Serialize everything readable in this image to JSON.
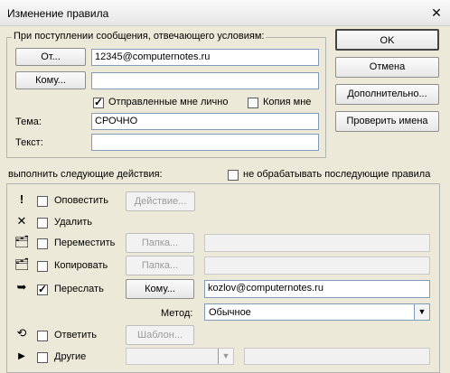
{
  "window": {
    "title": "Изменение правила",
    "close_glyph": "✕"
  },
  "conditions": {
    "group_title": "При поступлении сообщения, отвечающего условиям:",
    "from_button": "От...",
    "from_value": "12345@computernotes.ru",
    "to_button": "Кому...",
    "to_value": "",
    "sent_to_me_label": "Отправленные мне лично",
    "sent_to_me_checked": true,
    "cc_label": "Копия мне",
    "cc_checked": false,
    "subject_label": "Тема:",
    "subject_value": "СРОЧНО",
    "body_label": "Текст:",
    "body_value": ""
  },
  "side_buttons": {
    "ok": "OK",
    "cancel": "Отмена",
    "advanced": "Дополнительно...",
    "check_names": "Проверить имена"
  },
  "actions": {
    "header": "выполнить следующие действия:",
    "stop_processing_label": "не обрабатывать последующие правила",
    "stop_processing_checked": false,
    "notify": {
      "label": "Оповестить",
      "checked": false,
      "button": "Действие..."
    },
    "delete": {
      "label": "Удалить",
      "checked": false
    },
    "move": {
      "label": "Переместить",
      "checked": false,
      "button": "Папка...",
      "value": ""
    },
    "copy": {
      "label": "Копировать",
      "checked": false,
      "button": "Папка...",
      "value": ""
    },
    "forward": {
      "label": "Переслать",
      "checked": true,
      "button": "Кому...",
      "value": "kozlov@computernotes.ru"
    },
    "method": {
      "label": "Метод:",
      "value": "Обычное"
    },
    "reply": {
      "label": "Ответить",
      "checked": false,
      "button": "Шаблон..."
    },
    "other": {
      "label": "Другие",
      "checked": false,
      "value": ""
    }
  },
  "icons": {
    "notify": "exclamation-icon",
    "delete": "x-delete-icon",
    "move": "move-folder-icon",
    "copy": "copy-folder-icon",
    "forward": "forward-icon",
    "reply": "reply-icon",
    "other": "triangle-right-icon"
  }
}
